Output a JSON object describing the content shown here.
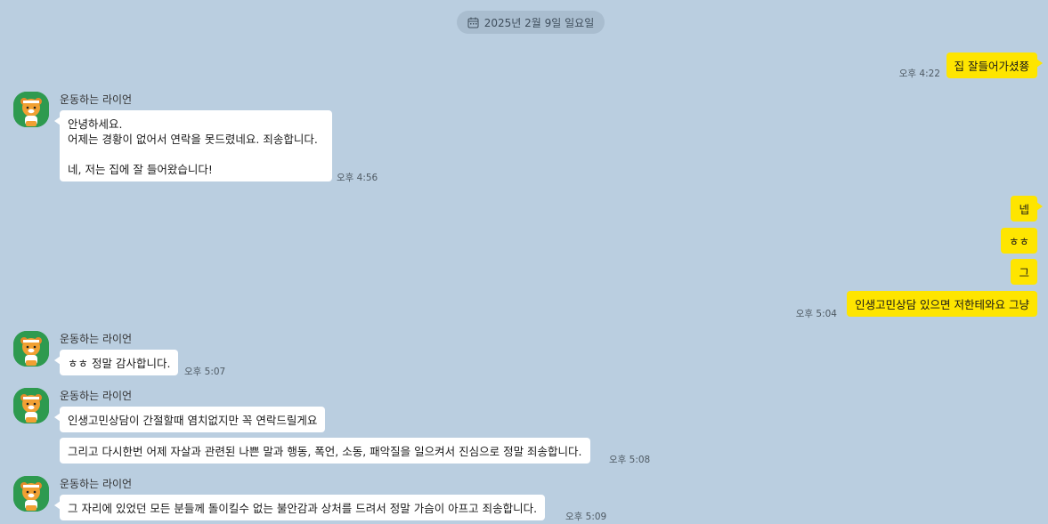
{
  "date_divider": {
    "icon": "calendar-icon",
    "label": "2025년 2월 9일 일요일"
  },
  "sender_name": "운동하는 라이언",
  "messages": {
    "m1": {
      "text": "집 잘들어가셨쭁",
      "time": "오후 4:22"
    },
    "m2": {
      "text": "안녕하세요.\n어제는 경황이 없어서 연락을 못드렸네요. 죄송합니다.\n\n네, 저는 집에 잘 들어왔습니다!",
      "time": "오후 4:56"
    },
    "m3": {
      "text": "넵"
    },
    "m4": {
      "text": "ㅎㅎ"
    },
    "m5": {
      "text": "그"
    },
    "m6": {
      "text": "인생고민상담 있으면 저한테와요 그냥",
      "time": "오후 5:04"
    },
    "m7": {
      "text": "ㅎㅎ 정말 감사합니다.",
      "time": "오후 5:07"
    },
    "m8": {
      "text": "인생고민상담이 간절할때 염치없지만 꼭 연락드릴게요"
    },
    "m9": {
      "text": "그리고 다시한번 어제 자살과 관련된 나쁜 말과 행동, 폭언, 소동, 패악질을 일으켜서 진심으로 정말 죄송합니다.",
      "time": "오후 5:08"
    },
    "m10": {
      "text": "그 자리에 있었던 모든 분들께 돌이킬수 없는 불안감과 상처를 드려서 정말 가슴이 아프고 죄송합니다.",
      "time": "오후 5:09"
    }
  },
  "colors": {
    "background": "#bacee0",
    "my_bubble": "#fee500",
    "their_bubble": "#ffffff",
    "avatar_bg": "#2e9a4f"
  },
  "avatar_icon": "ryan-character-icon"
}
